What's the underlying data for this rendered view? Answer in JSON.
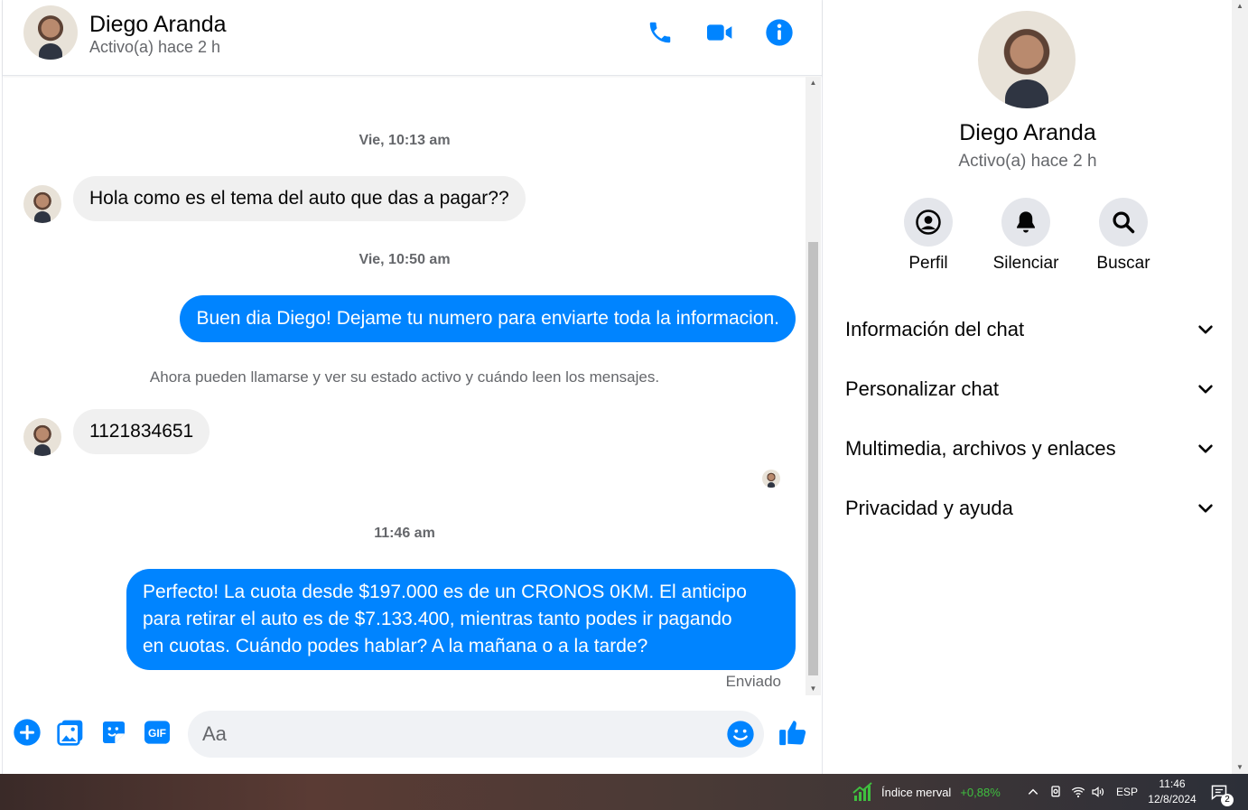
{
  "header": {
    "name": "Diego Aranda",
    "status": "Activo(a) hace 2 h"
  },
  "messages": {
    "ts1": "Vie, 10:13 am",
    "msg1": "Hola como es el tema del auto que das a pagar??",
    "ts2": "Vie, 10:50 am",
    "msg2": "Buen dia Diego! Dejame tu numero para enviarte toda la informacion.",
    "system": "Ahora pueden llamarse y ver su estado activo y cuándo leen los mensajes.",
    "msg3": "1121834651",
    "ts3": "11:46 am",
    "msg4_line1": "Perfecto! La cuota desde $197.000 es de un CRONOS 0KM. El anticipo",
    "msg4_line2": "para retirar el auto es de $7.133.400, mientras tanto podes ir pagando",
    "msg4_line3": "en cuotas. Cuándo podes hablar? A la mañana o a la tarde?",
    "sent_label": "Enviado"
  },
  "composer": {
    "placeholder": "Aa"
  },
  "sidebar": {
    "name": "Diego Aranda",
    "status": "Activo(a) hace 2 h",
    "actions": [
      {
        "label": "Perfil",
        "icon": "profile-icon"
      },
      {
        "label": "Silenciar",
        "icon": "bell-icon"
      },
      {
        "label": "Buscar",
        "icon": "search-icon"
      }
    ],
    "sections": [
      {
        "label": "Información del chat"
      },
      {
        "label": "Personalizar chat"
      },
      {
        "label": "Multimedia, archivos y enlaces"
      },
      {
        "label": "Privacidad y ayuda"
      }
    ]
  },
  "taskbar": {
    "stock_name": "Índice merval",
    "stock_change": "+0,88%",
    "lang": "ESP",
    "time": "11:46",
    "date": "12/8/2024",
    "notif_count": "2"
  },
  "colors": {
    "accent": "#0084ff",
    "bubble_in": "#f0f0f0",
    "muted_text": "#65676b",
    "stock_up": "#3fbf3f"
  }
}
